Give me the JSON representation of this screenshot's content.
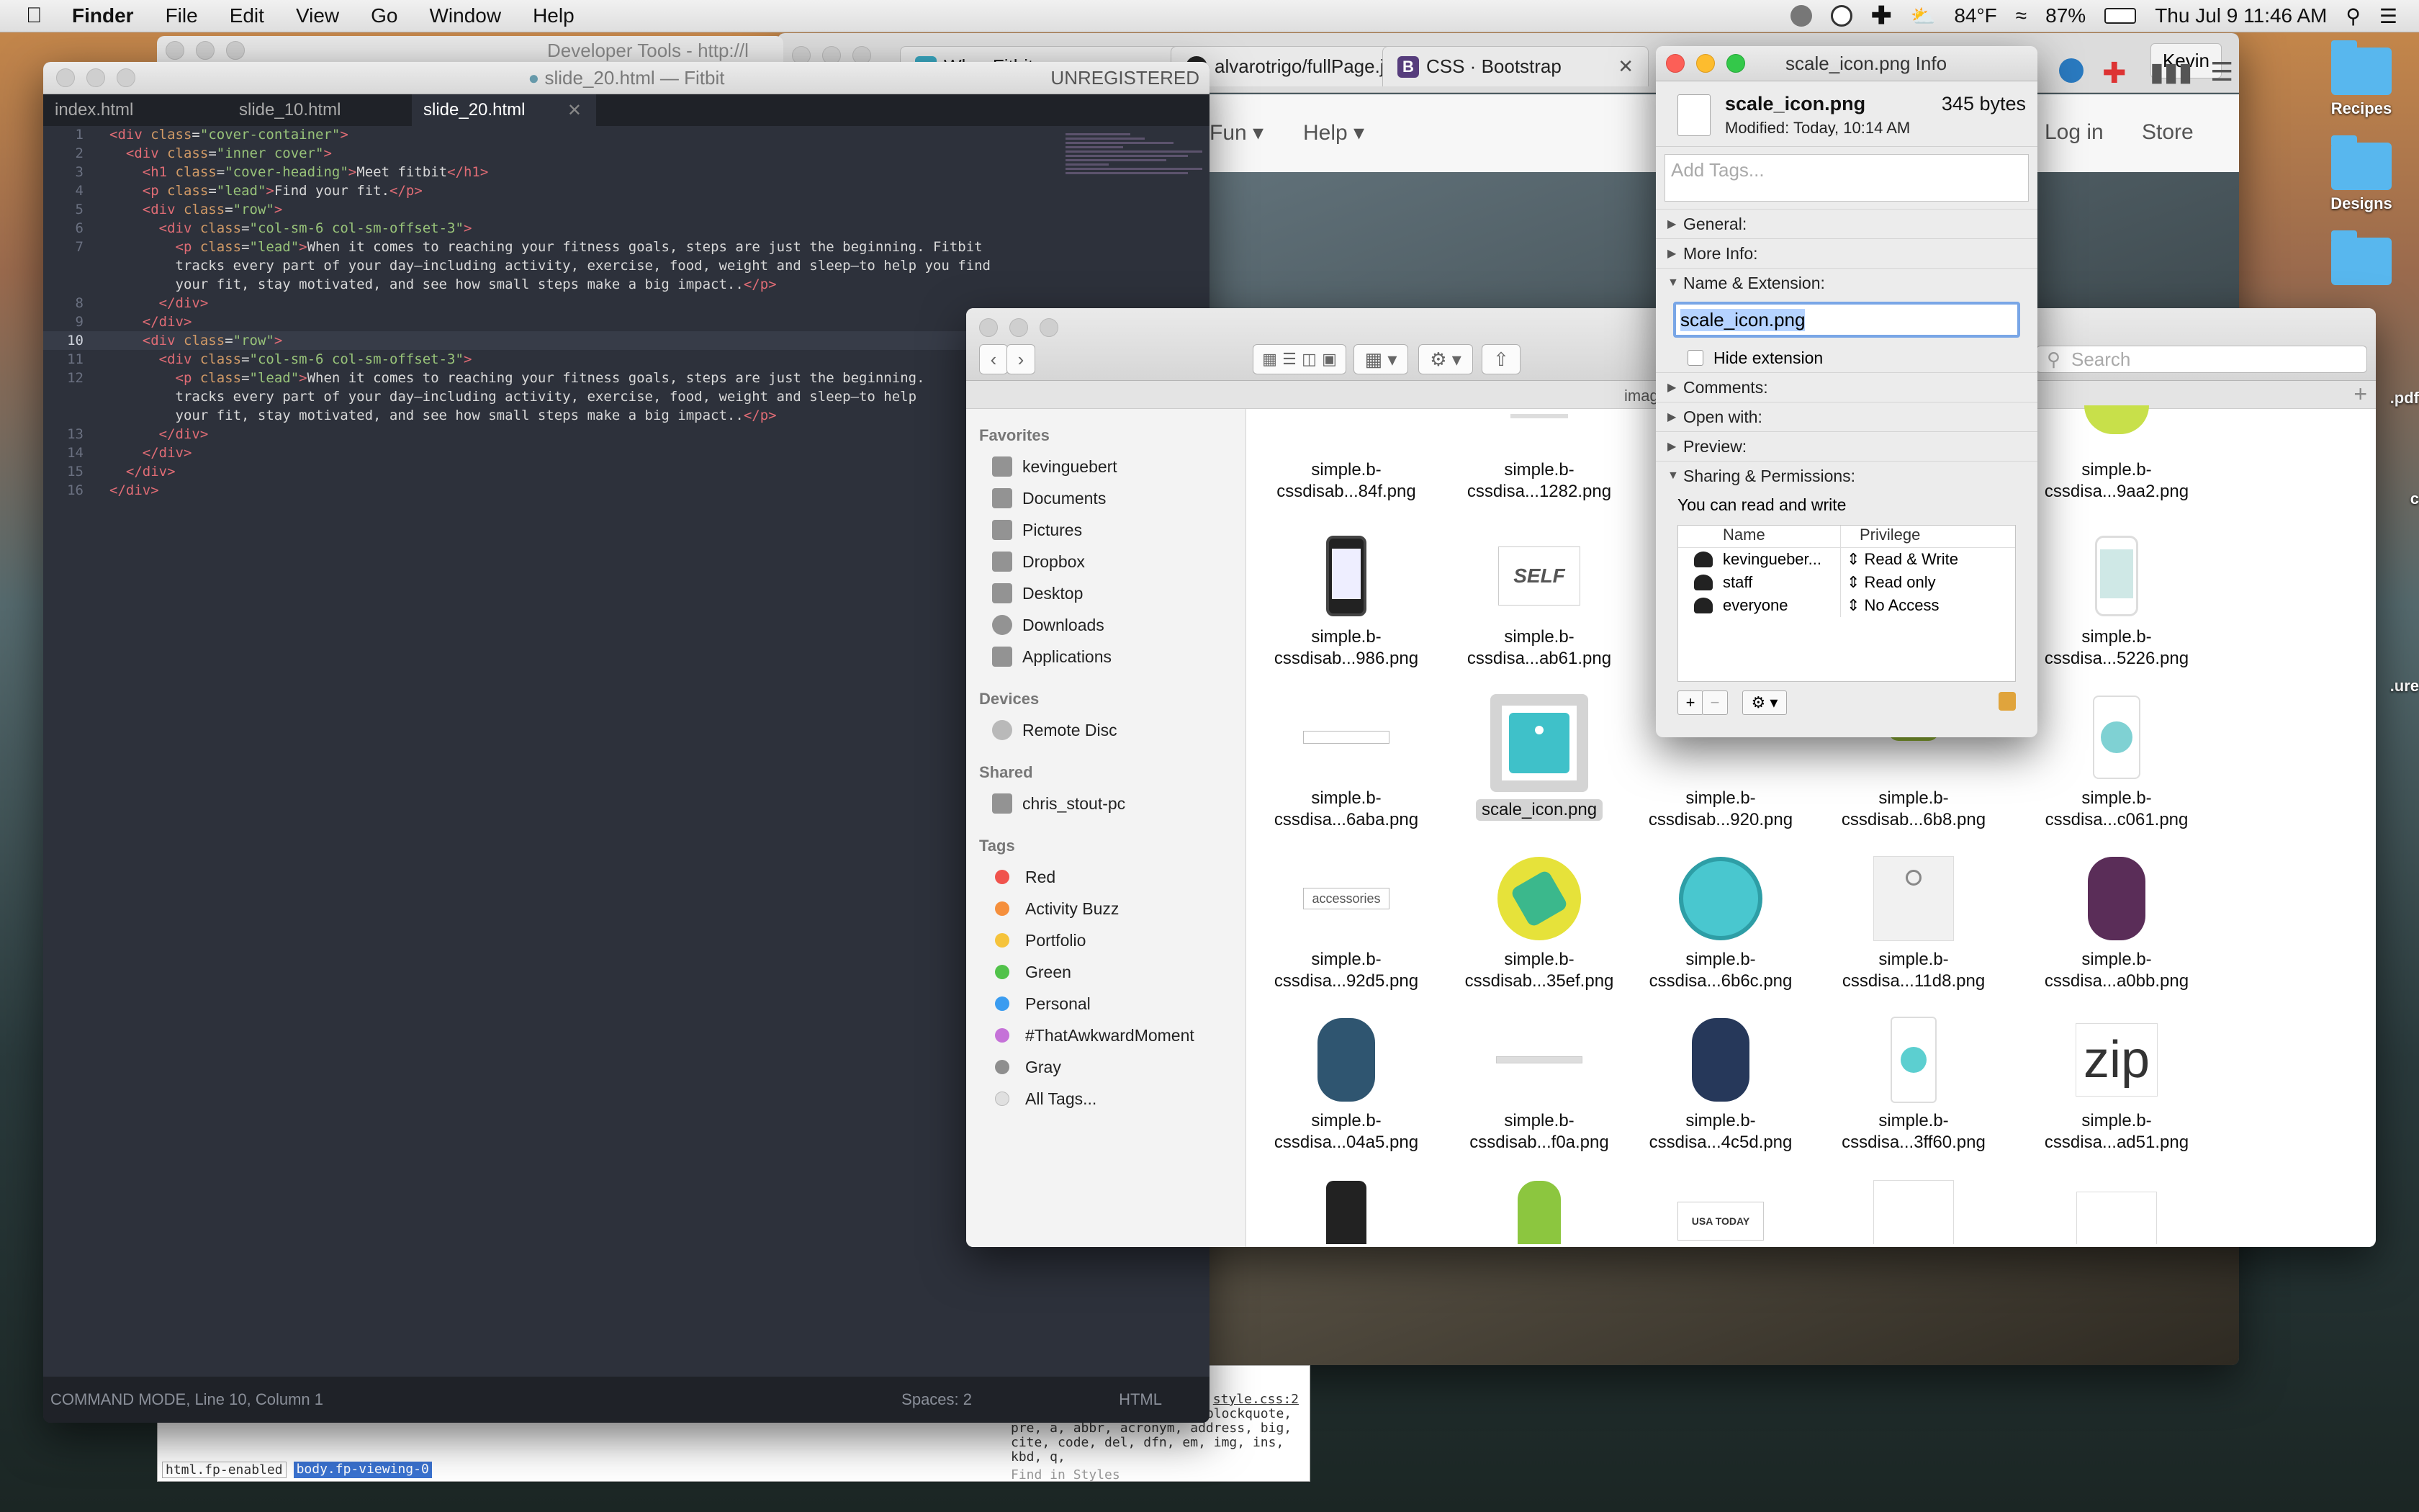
{
  "menubar": {
    "app": "Finder",
    "items": [
      "File",
      "Edit",
      "View",
      "Go",
      "Window",
      "Help"
    ],
    "weather": "84°F",
    "battery": "87%",
    "datetime": "Thu Jul 9  11:46 AM",
    "user": "Kevin"
  },
  "desktop": {
    "icons": [
      "Recipes",
      "Designs",
      ".pdf",
      "c",
      ".ure"
    ]
  },
  "browser": {
    "tabs": [
      "Wh... Fitbit",
      "alvarotrigo/fullPage.js",
      "CSS · Bootstrap"
    ],
    "nav": [
      "Fun",
      "Help",
      "Log in",
      "Store"
    ],
    "profile": "Kevin"
  },
  "devtools": {
    "title": "Developer Tools - http://l",
    "breadcrumb": [
      "html.fp-enabled",
      "body.fp-viewing-0"
    ],
    "source_link": "style.css:2",
    "css_text": ", h2, h3, h4, h5, h6, p, blockquote, pre, a, abbr, acronym, address, big, cite, code, del, dfn, em, img, ins, kbd, q,",
    "find": "Find in Styles"
  },
  "editor": {
    "title": "slide_20.html — Fitbit",
    "unregistered": "UNREGISTERED",
    "tabs": [
      "index.html",
      "slide_10.html",
      "slide_20.html"
    ],
    "status_left": "COMMAND MODE, Line 10, Column 1",
    "spaces": "Spaces: 2",
    "syntax": "HTML",
    "line_numbers": [
      "1",
      "2",
      "3",
      "4",
      "5",
      "6",
      "7",
      "",
      "",
      "8",
      "9",
      "10",
      "11",
      "12",
      "",
      "",
      "13",
      "14",
      "15",
      "16"
    ]
  },
  "finder": {
    "path_fragment": "imag",
    "search_placeholder": "Search",
    "sidebar": {
      "favorites_label": "Favorites",
      "favorites": [
        "kevinguebert",
        "Documents",
        "Pictures",
        "Dropbox",
        "Desktop",
        "Downloads",
        "Applications"
      ],
      "devices_label": "Devices",
      "devices": [
        "Remote Disc"
      ],
      "shared_label": "Shared",
      "shared": [
        "chris_stout-pc"
      ],
      "tags_label": "Tags",
      "tags": [
        {
          "name": "Red",
          "color": "#f0534d"
        },
        {
          "name": "Activity Buzz",
          "color": "#f58f3c"
        },
        {
          "name": "Portfolio",
          "color": "#f5c33b"
        },
        {
          "name": "Green",
          "color": "#51c24a"
        },
        {
          "name": "Personal",
          "color": "#3a9cf0"
        },
        {
          "name": "#ThatAwkwardMoment",
          "color": "#c572d8"
        },
        {
          "name": "Gray",
          "color": "#8e8e8e"
        },
        {
          "name": "All Tags...",
          "color": "#e0e0e0"
        }
      ]
    },
    "files": [
      [
        "simple.b-",
        "cssdisab...84f.png"
      ],
      [
        "simple.b-",
        "cssdisa...1282.png"
      ],
      [
        "simple.b-",
        "cssdisa...9aa2.png"
      ],
      [
        "simple.b-",
        "cssdisab...986.png"
      ],
      [
        "simple.b-",
        "cssdisa...ab61.png"
      ],
      [
        "simple.b-",
        "cssdisa...5226.png"
      ],
      [
        "simple.b-",
        "cssdisa...6aba.png"
      ],
      [
        "scale_icon.png",
        ""
      ],
      [
        "simple.b-",
        "cssdisab...920.png"
      ],
      [
        "simple.b-",
        "cssdisab...6b8.png"
      ],
      [
        "simple.b-",
        "cssdisa...c061.png"
      ],
      [
        "simple.b-",
        "cssdisa...92d5.png"
      ],
      [
        "simple.b-",
        "cssdisab...35ef.png"
      ],
      [
        "simple.b-",
        "cssdisa...6b6c.png"
      ],
      [
        "simple.b-",
        "cssdisa...11d8.png"
      ],
      [
        "simple.b-",
        "cssdisa...a0bb.png"
      ],
      [
        "simple.b-",
        "cssdisa...04a5.png"
      ],
      [
        "simple.b-",
        "cssdisab...f0a.png"
      ],
      [
        "simple.b-",
        "cssdisa...4c5d.png"
      ],
      [
        "simple.b-",
        "cssdisa...3ff60.png"
      ],
      [
        "simple.b-",
        "cssdisa...ad51.png"
      ]
    ],
    "thumb_texts": {
      "self": "SELF",
      "accessories": "accessories",
      "zip": "zip",
      "usatoday": "USA TODAY"
    }
  },
  "info": {
    "title": "scale_icon.png Info",
    "filename": "scale_icon.png",
    "size": "345 bytes",
    "modified": "Modified: Today, 10:14 AM",
    "tags_placeholder": "Add Tags...",
    "sections": {
      "general": "General:",
      "more_info": "More Info:",
      "name_ext": "Name & Extension:",
      "comments": "Comments:",
      "open_with": "Open with:",
      "preview": "Preview:",
      "sharing": "Sharing & Permissions:"
    },
    "name_value": "scale_icon.png",
    "hide_extension": "Hide extension",
    "perm_note": "You can read and write",
    "perm_cols": [
      "Name",
      "Privilege"
    ],
    "permissions": [
      {
        "name": "kevingueber...",
        "privilege": "Read & Write"
      },
      {
        "name": "staff",
        "privilege": "Read only"
      },
      {
        "name": "everyone",
        "privilege": "No Access"
      }
    ]
  }
}
